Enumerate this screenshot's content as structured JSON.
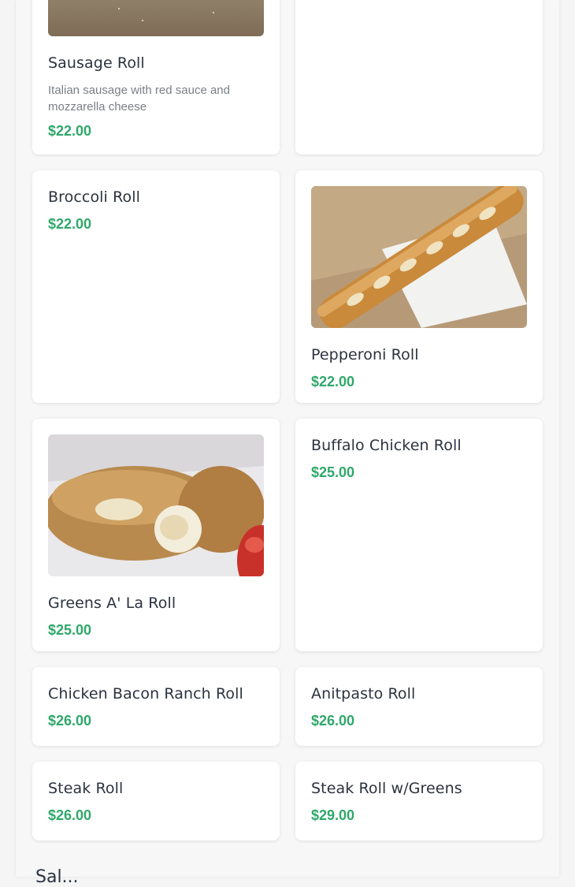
{
  "menu": {
    "items": [
      {
        "name": "Sausage Roll",
        "description": "Italian sausage with red sauce and mozzarella cheese",
        "price": "$22.00",
        "image": "sausage-roll-photo"
      },
      {
        "name": "",
        "price": ""
      },
      {
        "name": "Broccoli Roll",
        "price": "$22.00"
      },
      {
        "name": "Pepperoni Roll",
        "price": "$22.00",
        "image": "pepperoni-roll-photo"
      },
      {
        "name": "Greens A' La Roll",
        "price": "$25.00",
        "image": "greens-roll-photo"
      },
      {
        "name": "Buffalo Chicken Roll",
        "price": "$25.00"
      },
      {
        "name": "Chicken Bacon Ranch Roll",
        "price": "$26.00"
      },
      {
        "name": "Anitpasto Roll",
        "price": "$26.00"
      },
      {
        "name": "Steak Roll",
        "price": "$26.00"
      },
      {
        "name": "Steak Roll w/Greens",
        "price": "$29.00"
      }
    ],
    "next_section_heading": "Sal..."
  },
  "colors": {
    "price": "#2fa86a",
    "name": "#2b3340",
    "description": "#7a7f87",
    "card": "#ffffff",
    "background": "#f7f7f7"
  }
}
